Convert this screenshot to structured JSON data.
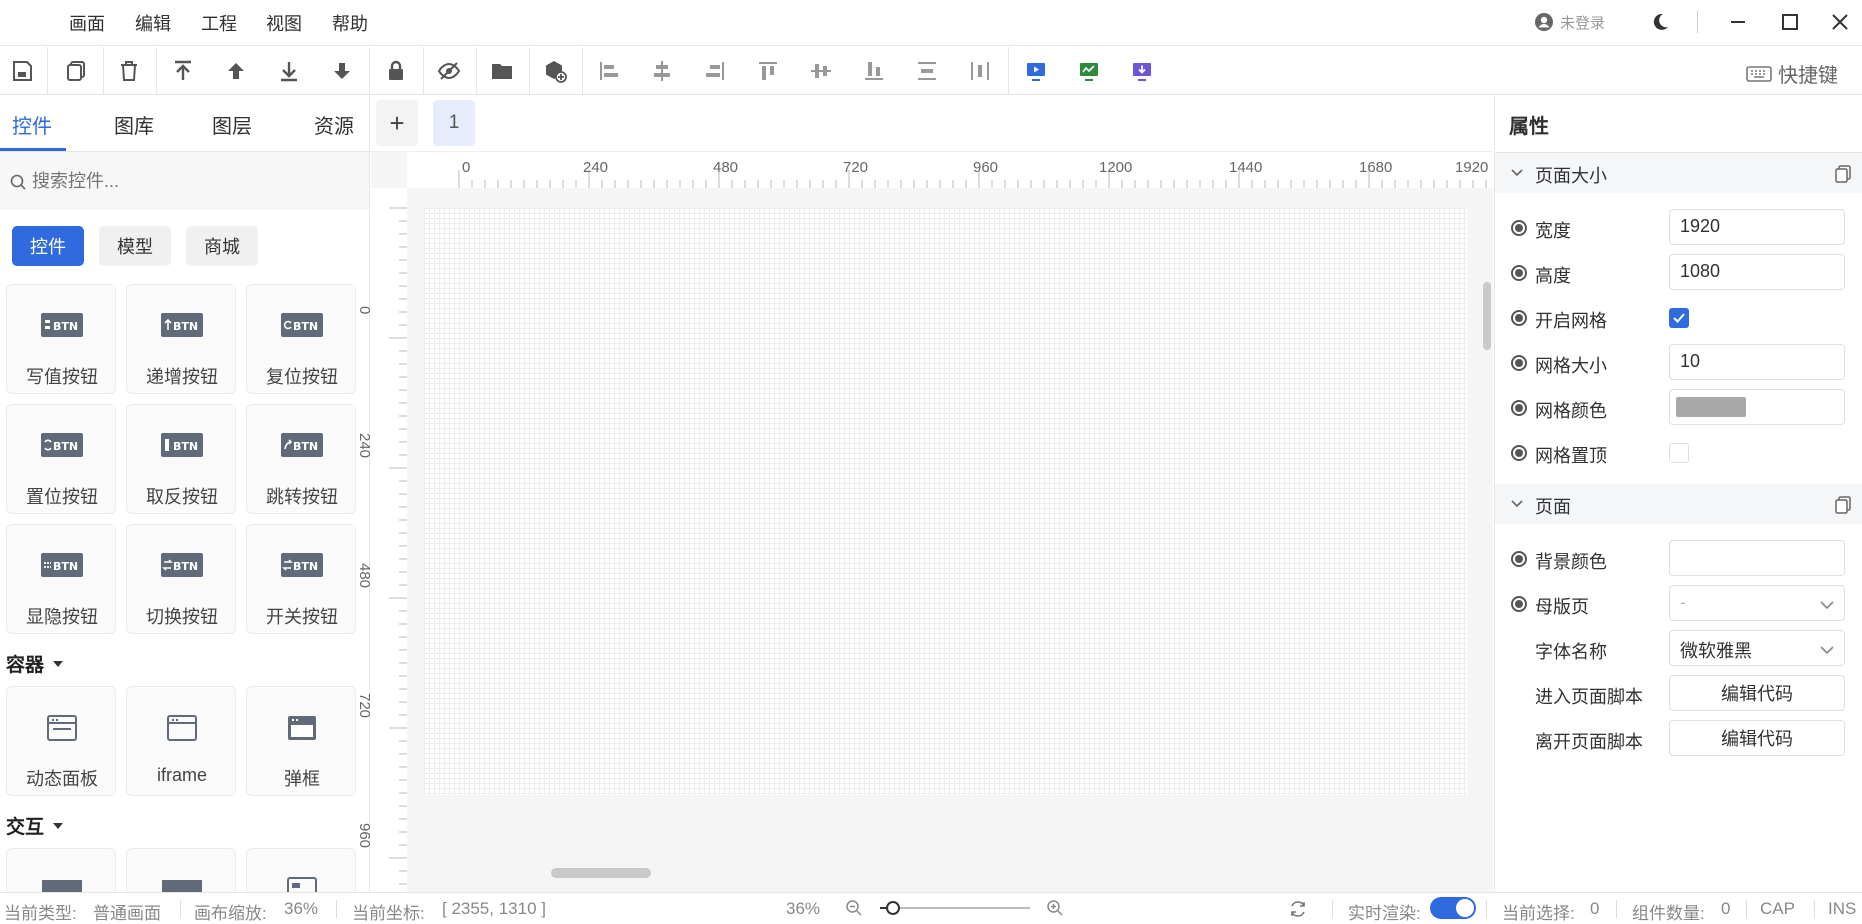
{
  "menu": {
    "items": [
      "画面",
      "编辑",
      "工程",
      "视图",
      "帮助"
    ],
    "login": "未登录"
  },
  "toolbar": {
    "shortcut_label": "快捷键"
  },
  "left": {
    "tabs": [
      "控件",
      "图库",
      "图层",
      "资源"
    ],
    "search_placeholder": "搜索控件...",
    "chips": [
      "控件",
      "模型",
      "商城"
    ],
    "buttons": [
      "写值按钮",
      "递增按钮",
      "复位按钮",
      "置位按钮",
      "取反按钮",
      "跳转按钮",
      "显隐按钮",
      "切换按钮",
      "开关按钮"
    ],
    "section_container": "容器",
    "containers": [
      "动态面板",
      "iframe",
      "弹框"
    ],
    "section_interact": "交互"
  },
  "pages": {
    "add": "+",
    "current": "1"
  },
  "ruler": {
    "h": [
      "0",
      "240",
      "480",
      "720",
      "960",
      "1200",
      "1440",
      "1680",
      "1920"
    ],
    "v": [
      "0",
      "240",
      "480",
      "720",
      "960"
    ]
  },
  "props": {
    "title": "属性",
    "section_size": "页面大小",
    "width_label": "宽度",
    "width_value": "1920",
    "height_label": "高度",
    "height_value": "1080",
    "grid_on_label": "开启网格",
    "grid_size_label": "网格大小",
    "grid_size_value": "10",
    "grid_color_label": "网格颜色",
    "grid_top_label": "网格置顶",
    "section_page": "页面",
    "bg_label": "背景颜色",
    "master_label": "母版页",
    "master_value": "-",
    "font_label": "字体名称",
    "font_value": "微软雅黑",
    "enter_label": "进入页面脚本",
    "enter_btn": "编辑代码",
    "leave_label": "离开页面脚本",
    "leave_btn": "编辑代码"
  },
  "status": {
    "type_label": "当前类型:",
    "type_value": "普通画面",
    "zoom_label": "画布缩放:",
    "zoom_value": "36%",
    "coord_label": "当前坐标:",
    "coord_value": "[ 2355, 1310 ]",
    "zoom_slider_value": "36%",
    "render_label": "实时渲染:",
    "sel_label": "当前选择:",
    "sel_value": "0",
    "count_label": "组件数量:",
    "count_value": "0",
    "cap": "CAP",
    "ins": "INS"
  },
  "colors": {
    "accent": "#2f6bde",
    "grid_color": "#a8a8a8"
  }
}
